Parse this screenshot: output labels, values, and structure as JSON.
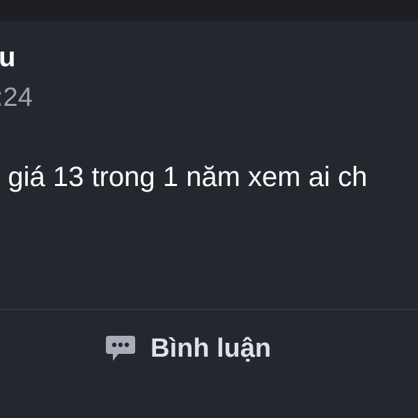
{
  "post": {
    "author": "u",
    "timestamp": ":24",
    "text": "g giá 13 trong 1 năm xem ai ch"
  },
  "actions": {
    "comment_label": "Bình luận",
    "comment_icon": "speech-bubble-icon"
  },
  "colors": {
    "background": "#25272f",
    "text": "#ffffff",
    "muted_text": "#9fa3ab",
    "icon": "#a8adb8"
  }
}
